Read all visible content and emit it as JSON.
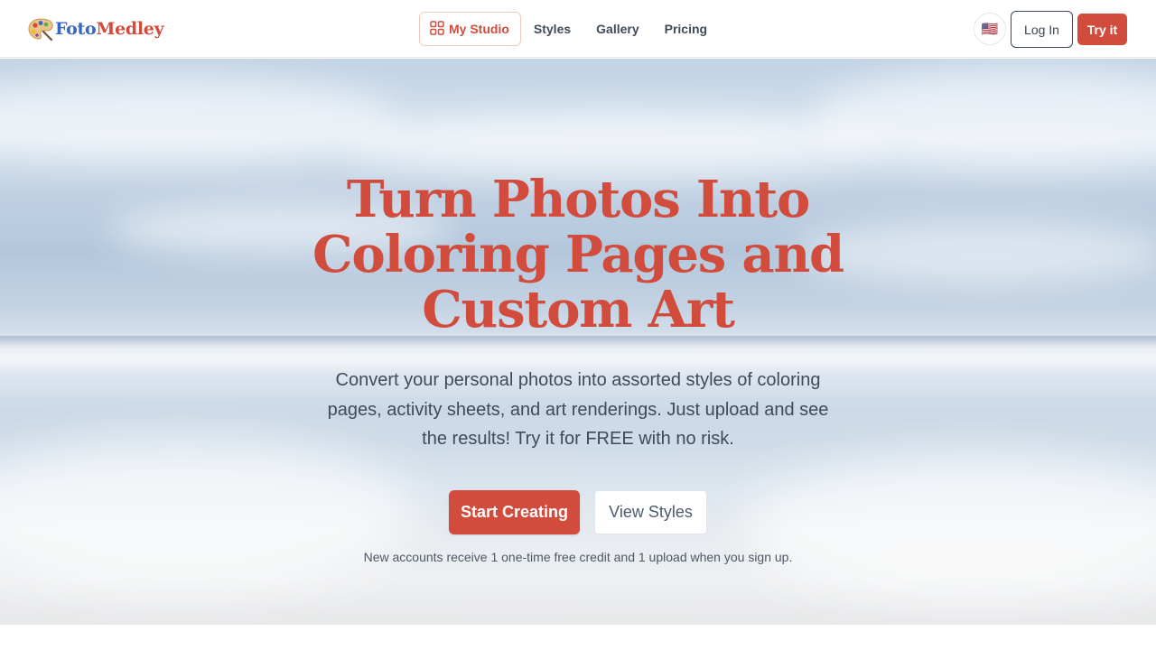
{
  "brand": {
    "name_part1": "Foto",
    "name_part2": "Medley",
    "logo_icon": "palette-icon",
    "colors": {
      "primary": "#d14c3c",
      "blue": "#3a67c4",
      "text": "#3f4a5a"
    }
  },
  "nav": {
    "items": [
      {
        "label": "My Studio",
        "icon": "grid-icon",
        "active": true
      },
      {
        "label": "Styles"
      },
      {
        "label": "Gallery"
      },
      {
        "label": "Pricing"
      }
    ]
  },
  "header_actions": {
    "language_flag": "🇺🇸",
    "language_icon": "us-flag-icon",
    "login_label": "Log In",
    "try_label": "Try it"
  },
  "hero": {
    "headline_line1": "Turn Photos Into",
    "headline_line2": "Coloring Pages and",
    "headline_line3": "Custom Art",
    "subtext_line1": "Convert your personal photos into assorted styles of coloring",
    "subtext_line2": "pages, activity sheets, and art renderings. Just upload and see",
    "subtext_line3": "the results! Try it for FREE with no risk.",
    "primary_cta": "Start Creating",
    "secondary_cta": "View Styles",
    "footnote": "New accounts receive 1 one-time free credit and 1 upload when you sign up."
  }
}
